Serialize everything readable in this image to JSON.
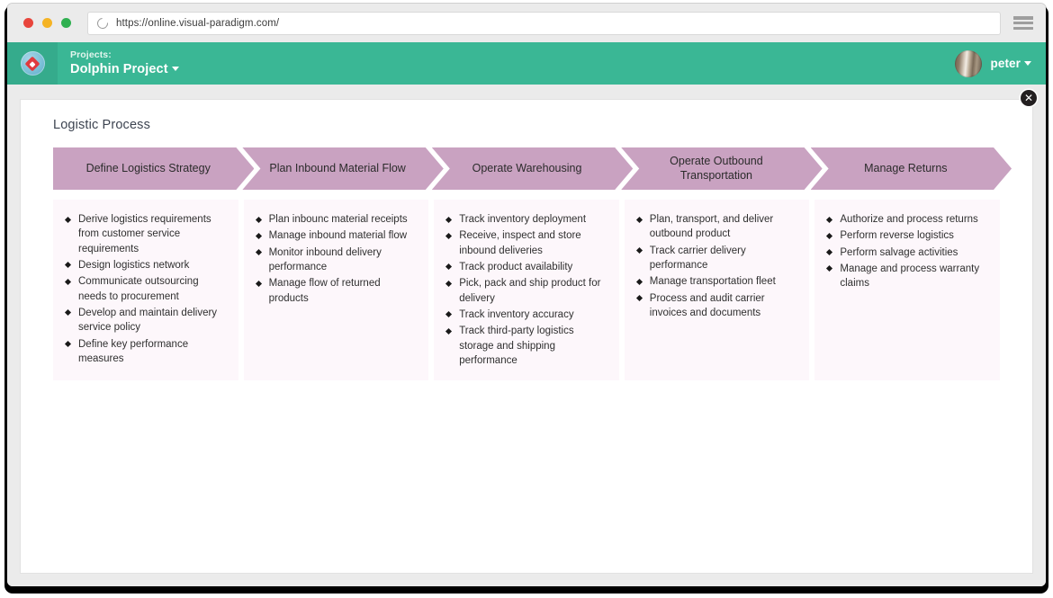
{
  "browser": {
    "url": "https://online.visual-paradigm.com/",
    "reload_icon": "reload-icon",
    "menu_icon": "hamburger-menu-icon",
    "traffic_lights": [
      "close",
      "minimize",
      "maximize"
    ]
  },
  "app_header": {
    "logo_icon": "visual-paradigm-logo",
    "projects_label": "Projects:",
    "project_name": "Dolphin Project",
    "project_caret_icon": "caret-down-icon",
    "user_name": "peter",
    "user_caret_icon": "caret-down-icon",
    "avatar_icon": "user-avatar",
    "background_color": "#3ab795"
  },
  "card": {
    "title": "Logistic Process",
    "close_icon": "close-icon",
    "close_label": "✕"
  },
  "diagram": {
    "chevron_color": "#c9a2c1",
    "column_color": "#fdf7fb",
    "stages": [
      {
        "title": "Define Logistics Strategy",
        "items": [
          "Derive logistics requirements from customer service requirements",
          "Design logistics network",
          "Communicate outsourcing needs to procurement",
          "Develop and maintain delivery service policy",
          "Define key performance measures"
        ]
      },
      {
        "title": "Plan Inbound Material Flow",
        "items": [
          "Plan inbounc material receipts",
          "Manage inbound material flow",
          "Monitor inbound delivery performance",
          "Manage flow of returned products"
        ]
      },
      {
        "title": "Operate Warehousing",
        "items": [
          "Track inventory deployment",
          "Receive, inspect and store inbound deliveries",
          "Track product availability",
          "Pick, pack and ship product for delivery",
          "Track inventory accuracy",
          "Track third-party logistics storage and shipping performance"
        ]
      },
      {
        "title": "Operate Outbound Transportation",
        "items": [
          "Plan, transport, and deliver outbound product",
          "Track carrier delivery performance",
          "Manage transportation fleet",
          "Process and audit carrier invoices and documents"
        ]
      },
      {
        "title": "Manage Returns",
        "items": [
          "Authorize and process returns",
          "Perform reverse logistics",
          "Perform salvage activities",
          "Manage and process warranty claims"
        ]
      }
    ]
  }
}
